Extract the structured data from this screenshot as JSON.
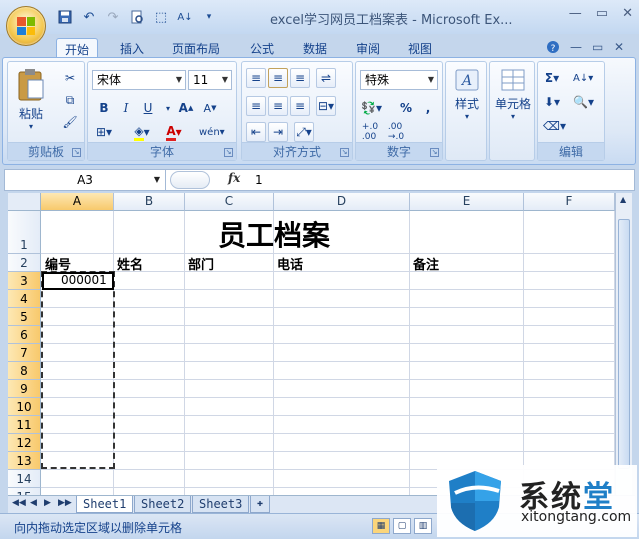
{
  "window": {
    "title": "excel学习网员工档案表 - Microsoft Ex...",
    "controls": [
      "—",
      "▭",
      "✕"
    ]
  },
  "tabs": [
    {
      "label": "开始",
      "active": true
    },
    {
      "label": "插入"
    },
    {
      "label": "页面布局"
    },
    {
      "label": "公式"
    },
    {
      "label": "数据"
    },
    {
      "label": "审阅"
    },
    {
      "label": "视图"
    }
  ],
  "ribbon": {
    "clipboard": {
      "label": "剪贴板",
      "paste": "粘贴"
    },
    "font": {
      "label": "字体",
      "name": "宋体",
      "size": "11"
    },
    "alignment": {
      "label": "对齐方式"
    },
    "number": {
      "label": "数字",
      "format": "特殊"
    },
    "styles": {
      "label": "样式"
    },
    "cells": {
      "label": "单元格"
    },
    "editing": {
      "label": "编辑"
    }
  },
  "formula_bar": {
    "name_box": "A3",
    "fx": "fx",
    "value": "1"
  },
  "grid": {
    "columns": [
      "A",
      "B",
      "C",
      "D",
      "E",
      "F"
    ],
    "rows": [
      "1",
      "2",
      "3",
      "4",
      "5",
      "6",
      "7",
      "8",
      "9",
      "10",
      "11",
      "12",
      "13",
      "14",
      "15"
    ],
    "title": "员工档案",
    "headers": [
      "编号",
      "姓名",
      "部门",
      "电话",
      "备注"
    ],
    "a3_value": "000001"
  },
  "sheets": [
    "Sheet1",
    "Sheet2",
    "Sheet3"
  ],
  "status": {
    "text": "向内拖动选定区域以删除单元格"
  },
  "watermark": {
    "title_a": "系统",
    "title_b": "堂",
    "url": "xitongtang.com"
  },
  "colors": {
    "accent": "#15428b",
    "ribbon_bg": "#dfe9f6",
    "selected_header": "#f8c96c",
    "watermark_blue": "#1f7fc7"
  }
}
